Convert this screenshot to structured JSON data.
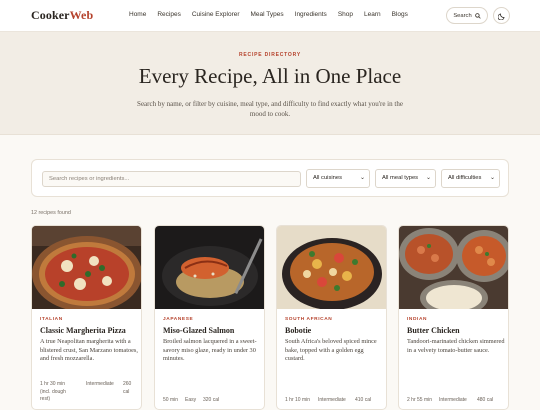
{
  "brand": {
    "part1": "Cooker",
    "part2": "Web"
  },
  "nav": [
    "Home",
    "Recipes",
    "Cuisine Explorer",
    "Meal Types",
    "Ingredients",
    "Shop",
    "Learn",
    "Blogs"
  ],
  "header": {
    "search_label": "Search",
    "search_icon": "search-icon",
    "theme_icon": "moon-icon"
  },
  "hero": {
    "eyebrow": "RECIPE DIRECTORY",
    "title": "Every Recipe, All in One Place",
    "subtitle": "Search by name, or filter by cuisine, meal type, and difficulty to find exactly what you're in the mood to cook."
  },
  "filters": {
    "search_placeholder": "Search recipes or ingredients...",
    "cuisine": "All cuisines",
    "meal_type": "All meal types",
    "difficulty": "All difficulties"
  },
  "results": {
    "count_text": "12 recipes found"
  },
  "colors": {
    "accent": "#b5422c",
    "hero_bg": "#f2ede5",
    "page_bg": "#fbf9f5"
  },
  "cards": [
    {
      "cuisine": "ITALIAN",
      "title": "Classic Margherita Pizza",
      "description": "A true Neapolitan margherita with a blistered crust, San Marzano tomatoes, and fresh mozzarella.",
      "time": "1 hr 30 min (incl. dough rest)",
      "difficulty": "Intermediate",
      "calories": "260 cal"
    },
    {
      "cuisine": "JAPANESE",
      "title": "Miso-Glazed Salmon",
      "description": "Broiled salmon lacquered in a sweet-savory miso glaze, ready in under 30 minutes.",
      "time": "50 min",
      "difficulty": "Easy",
      "calories": "320 cal"
    },
    {
      "cuisine": "SOUTH AFRICAN",
      "title": "Bobotie",
      "description": "South Africa's beloved spiced mince bake, topped with a golden egg custard.",
      "time": "1 hr 10 min",
      "difficulty": "Intermediate",
      "calories": "410 cal"
    },
    {
      "cuisine": "INDIAN",
      "title": "Butter Chicken",
      "description": "Tandoori-marinated chicken simmered in a velvety tomato-butter sauce.",
      "time": "2 hr 55 min",
      "difficulty": "Intermediate",
      "calories": "480 cal"
    }
  ]
}
